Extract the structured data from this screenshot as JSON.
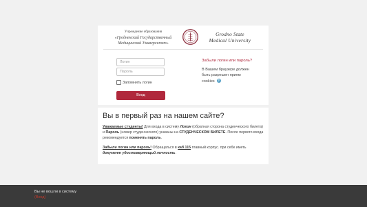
{
  "header": {
    "institution_ru": [
      "Учреждение образования",
      "«Гродненский Государственный",
      "Медицинский Университет»"
    ],
    "institution_en": [
      "Grodno State",
      "Medical University"
    ],
    "logo_icon": "university-seal"
  },
  "login_form": {
    "login_placeholder": "Логин",
    "password_placeholder": "Пароль",
    "remember_label": "Запомнить логин",
    "remember_checked": false,
    "submit_label": "Вход",
    "forgot_link": "Забыли логин или пароль?",
    "cookies_note": "В Вашем браузере должен быть разрешен прием cookies",
    "help_icon": "question-circle-icon"
  },
  "info": {
    "title": "Вы в первый раз на нашем сайте?",
    "p1": {
      "lead": "Уважаемые студенты!",
      "t1": " Для входа в систему ",
      "login": "Логин",
      "t2": " (обратная сторона студенческого билета) и ",
      "password": "Пароль",
      "t3": " (номер студенческого) указаны на ",
      "card": "СТУДЕНЧЕСКОМ БИЛЕТЕ",
      "t4": ". После первого входа рекомендуется ",
      "change": "поменять пароль",
      "t5": "."
    },
    "p2": {
      "lead": "Забыли логин или пароль!",
      "t1": " Обращаться в ",
      "room": "каб.115",
      "t2": " главный корпус. при себе иметь ",
      "doc": "документ удостоверяющий личность",
      "t3": "."
    }
  },
  "footer": {
    "status": "Вы не вошли в систему",
    "login_link": "(Вход)"
  },
  "colors": {
    "accent": "#b0283c",
    "background": "#f1f1f1",
    "footer_bg": "#3a3a3a"
  }
}
